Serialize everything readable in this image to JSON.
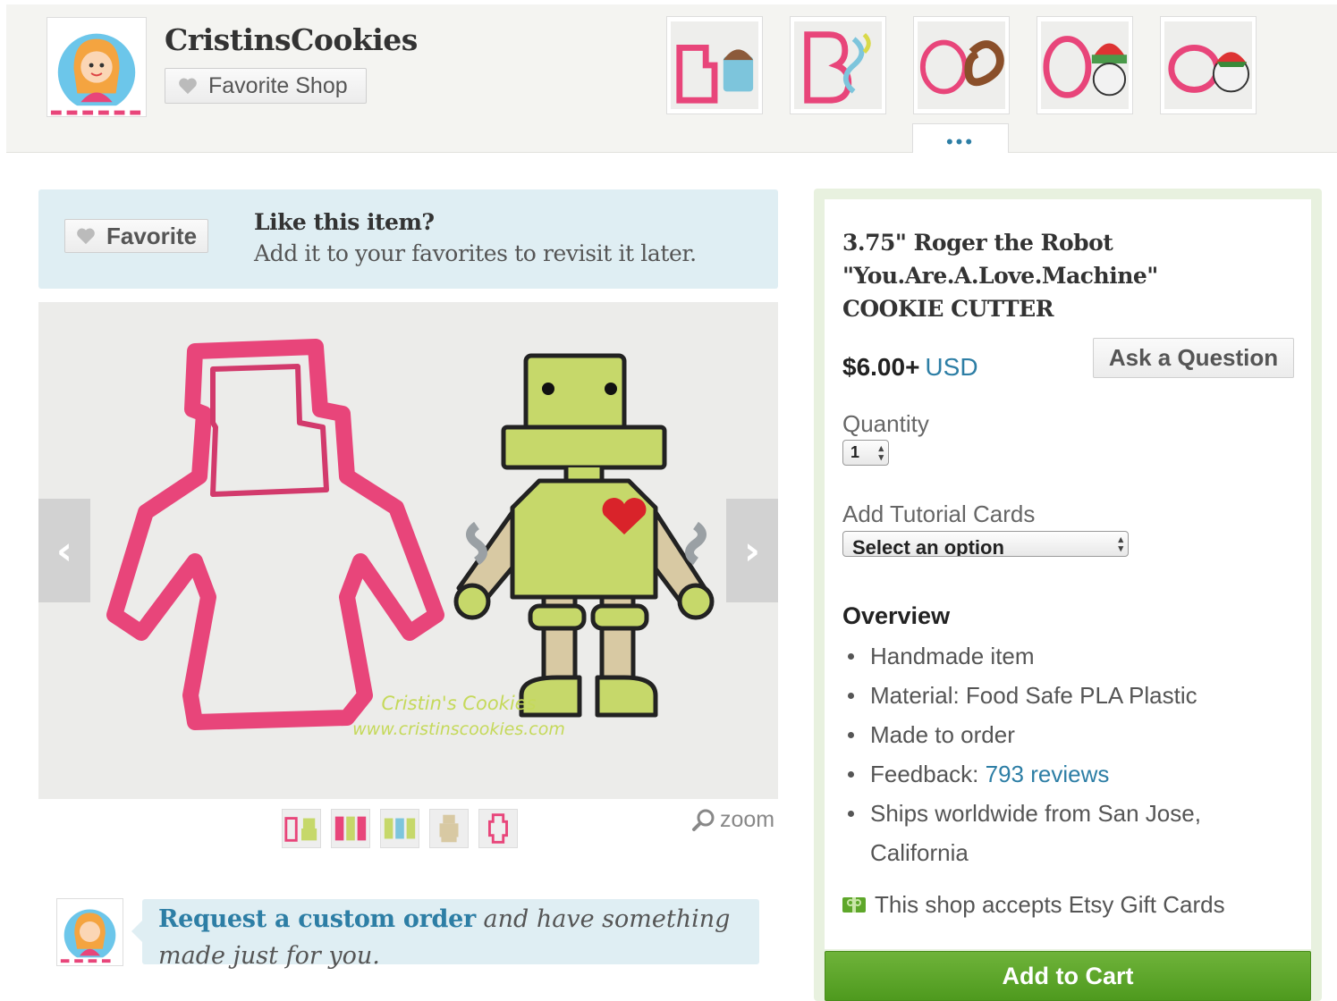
{
  "shop": {
    "name": "CristinsCookies",
    "favorite_label": "Favorite Shop",
    "more_label": "•••"
  },
  "favorite_banner": {
    "button_label": "Favorite",
    "title": "Like this item?",
    "subtitle": "Add it to your favorites to revisit it later."
  },
  "main_image": {
    "watermark_line1": "Cristin's Cookies",
    "watermark_line2": "www.cristinscookies.com",
    "prev_arrow": "‹",
    "next_arrow": "›"
  },
  "zoom_label": "zoom",
  "custom_order": {
    "link_text": "Request a custom order",
    "rest_text": " and have something made just for you."
  },
  "item": {
    "title": "3.75\" Roger the Robot \"You.Are.A.Love.Machine\" COOKIE CUTTER",
    "price": "$6.00+",
    "currency": "USD",
    "ask_label": "Ask a Question",
    "quantity_label": "Quantity",
    "quantity_value": "1",
    "tutorial_label": "Add Tutorial Cards",
    "tutorial_placeholder": "Select an option",
    "overview_title": "Overview",
    "overview": {
      "handmade": "Handmade item",
      "material": "Material: Food Safe PLA Plastic",
      "made_to_order": "Made to order",
      "feedback_prefix": "Feedback: ",
      "feedback_link": "793 reviews",
      "ships": "Ships worldwide from San Jose, California"
    },
    "giftcards": "This shop accepts Etsy Gift Cards",
    "add_to_cart": "Add to Cart"
  },
  "colors": {
    "link": "#2d7ea5",
    "cutter_pink": "#e8457a",
    "cookie_green": "#c6d86a",
    "cart_green": "#5ea72a",
    "banner_blue": "#dfeef3"
  }
}
